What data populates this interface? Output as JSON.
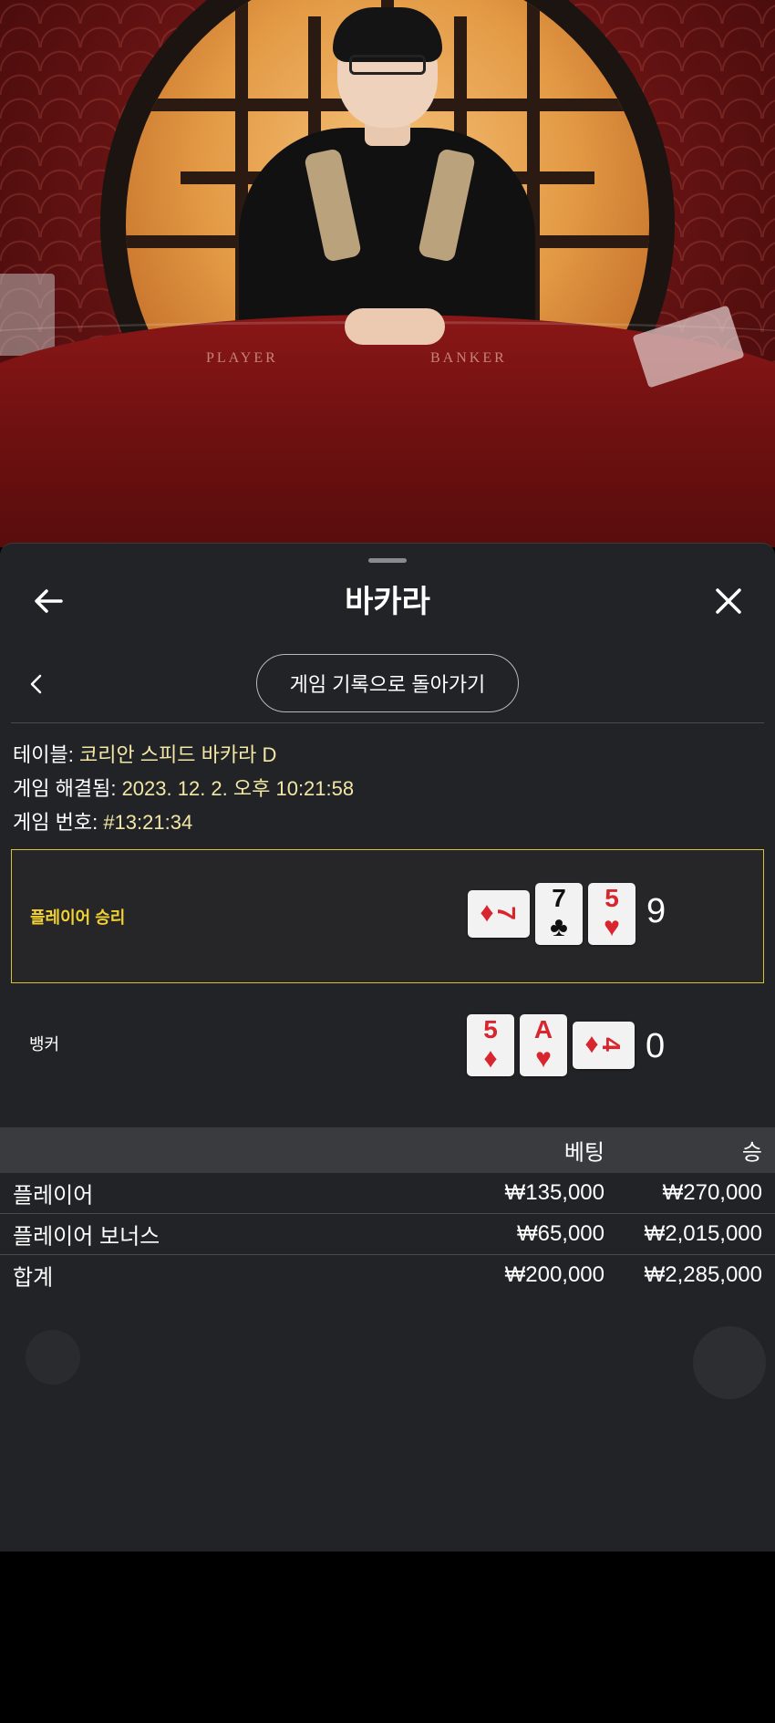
{
  "dialog": {
    "title": "바카라",
    "back_to_records_label": "게임 기록으로 돌아가기"
  },
  "info": {
    "table_label": "테이블:",
    "table_value": "코리안 스피드 바카라 D",
    "resolved_label": "게임 해결됨:",
    "resolved_value": "2023. 12. 2. 오후 10:21:58",
    "game_no_label": "게임 번호:",
    "game_no_value": "#13:21:34"
  },
  "hands": {
    "player": {
      "label": "플레이어 승리",
      "score": "9",
      "cards": [
        {
          "rank": "7",
          "suit": "♦",
          "color": "red",
          "orientation": "sideways"
        },
        {
          "rank": "7",
          "suit": "♣",
          "color": "black",
          "orientation": "upright"
        },
        {
          "rank": "5",
          "suit": "♥",
          "color": "red",
          "orientation": "upright"
        }
      ]
    },
    "banker": {
      "label": "뱅커",
      "score": "0",
      "cards": [
        {
          "rank": "5",
          "suit": "♦",
          "color": "red",
          "orientation": "upright"
        },
        {
          "rank": "A",
          "suit": "♥",
          "color": "red",
          "orientation": "upright"
        },
        {
          "rank": "4",
          "suit": "♦",
          "color": "red",
          "orientation": "sideways"
        }
      ]
    }
  },
  "bets": {
    "header": {
      "bet": "베팅",
      "win": "승"
    },
    "rows": [
      {
        "name": "플레이어",
        "bet": "₩135,000",
        "win": "₩270,000"
      },
      {
        "name": "플레이어 보너스",
        "bet": "₩65,000",
        "win": "₩2,015,000"
      }
    ],
    "total": {
      "name": "합계",
      "bet": "₩200,000",
      "win": "₩2,285,000"
    }
  },
  "video": {
    "table_left_text": "PLAYER",
    "table_right_text": "BANKER"
  },
  "colors": {
    "panel_bg": "#222326",
    "highlight_border": "#d9c03a",
    "player_win_text": "#f2d233",
    "info_value": "#f3e7a6",
    "card_red": "#d8262f"
  }
}
